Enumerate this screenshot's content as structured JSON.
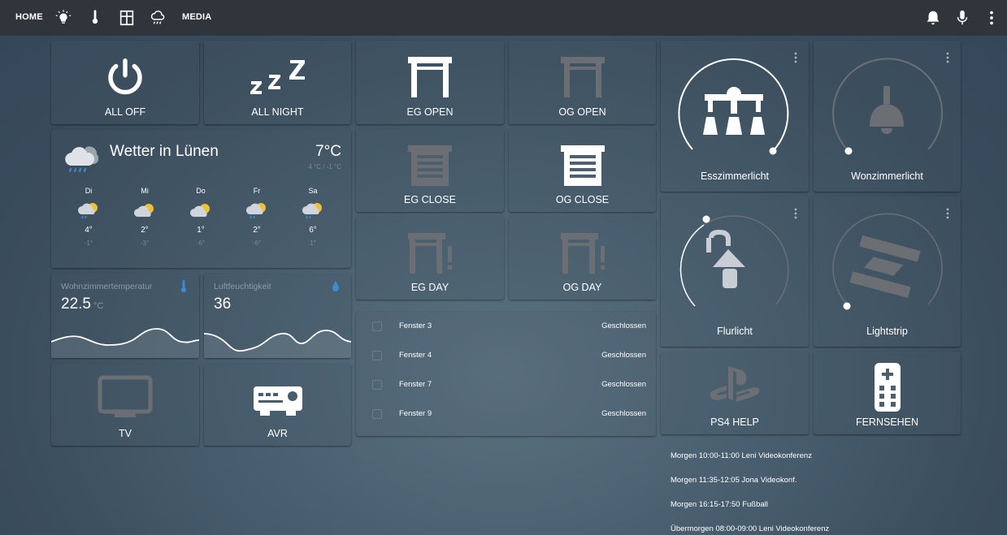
{
  "nav": {
    "home_label": "HOME",
    "media_label": "MEDIA",
    "tab_icons": [
      "lightbulb-icon",
      "thermometer-icon",
      "window-icon",
      "weather-icon"
    ],
    "right_icons": [
      "bell-icon",
      "microphone-icon",
      "more-vertical-icon"
    ]
  },
  "scenes": {
    "all_off": "ALL OFF",
    "all_night": "ALL NIGHT"
  },
  "weather": {
    "title": "Wetter in Lünen",
    "temperature": "7°C",
    "range": "4 °C / -1 °C",
    "forecast": [
      {
        "day": "Di",
        "hi": "4°",
        "lo": "-1°",
        "icon": "rain-sun-icon"
      },
      {
        "day": "Mi",
        "hi": "2°",
        "lo": "-3°",
        "icon": "cloud-sun-icon"
      },
      {
        "day": "Do",
        "hi": "1°",
        "lo": "-6°",
        "icon": "cloud-sun-icon"
      },
      {
        "day": "Fr",
        "hi": "2°",
        "lo": "-6°",
        "icon": "rain-sun-icon"
      },
      {
        "day": "Sa",
        "hi": "6°",
        "lo": "1°",
        "icon": "rain-sun-icon"
      }
    ]
  },
  "sensors": {
    "temperature": {
      "name": "Wohnzimmertemperatur",
      "value": "22.5",
      "unit": "°C"
    },
    "humidity": {
      "name": "Luftfeuchtigkeit",
      "value": "36"
    }
  },
  "media": {
    "tv": "TV",
    "avr": "AVR"
  },
  "covers": {
    "eg_open": "EG OPEN",
    "og_open": "OG OPEN",
    "eg_close": "EG CLOSE",
    "og_close": "OG CLOSE",
    "eg_day": "EG DAY",
    "og_day": "OG DAY"
  },
  "windows": [
    {
      "name": "Fenster 3",
      "state": "Geschlossen"
    },
    {
      "name": "Fenster 4",
      "state": "Geschlossen"
    },
    {
      "name": "Fenster 7",
      "state": "Geschlossen"
    },
    {
      "name": "Fenster 9",
      "state": "Geschlossen"
    }
  ],
  "lights": {
    "esszimmer": "Esszimmerlicht",
    "wohnzimmer": "Wonzimmerlicht",
    "flur": "Flurlicht",
    "lightstrip": "Lightstrip"
  },
  "remote": {
    "ps4": "PS4 HELP",
    "fernsehen": "FERNSEHEN"
  },
  "calendar": [
    "Morgen 10:00-11:00 Leni Videokonferenz",
    "Morgen 11:35-12:05 Jona Videokonf.",
    "Morgen 16:15-17:50 Fußball",
    "Übermorgen 08:00-09:00 Leni Videokonferenz"
  ],
  "colors": {
    "topbar": "#30343b",
    "icon_active": "#ffffff",
    "icon_inactive": "#6b6f74",
    "sensor_icon": "#3d8bd4"
  }
}
